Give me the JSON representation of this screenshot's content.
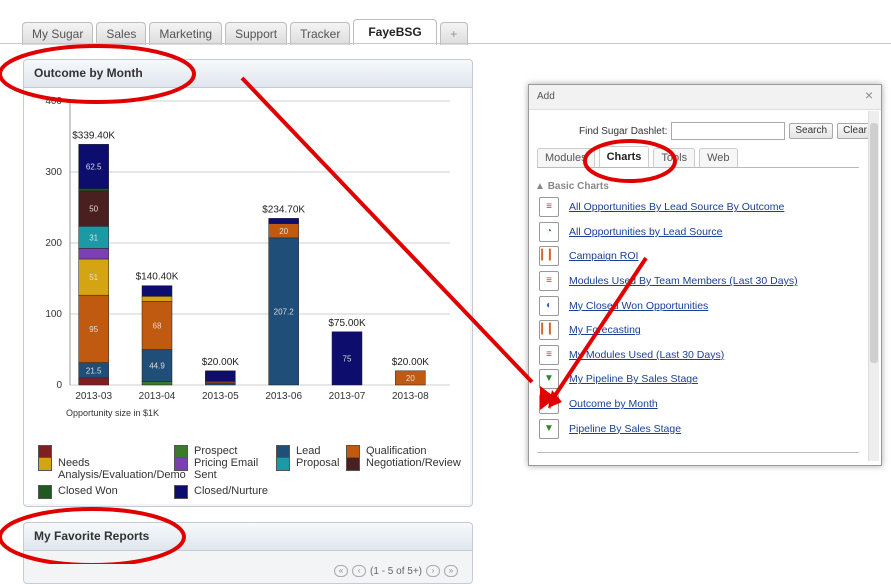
{
  "tabs": [
    "My Sugar",
    "Sales",
    "Marketing",
    "Support",
    "Tracker",
    "FayeBSG",
    "+"
  ],
  "dashlet_outcome": {
    "title": "Outcome by Month"
  },
  "dashlet_reports": {
    "title": "My Favorite Reports",
    "pager": "(1 - 5 of 5+)"
  },
  "chart_data": {
    "type": "bar",
    "title": "",
    "xlabel": "Opportunity size in $1K",
    "ylabel": "",
    "ylim": [
      0,
      400
    ],
    "yticks": [
      "0",
      "100",
      "200",
      "300",
      "400"
    ],
    "categories": [
      "2013-03",
      "2013-04",
      "2013-05",
      "2013-06",
      "2013-07",
      "2013-08"
    ],
    "totals": [
      "$339.40K",
      "$140.40K",
      "$20.00K",
      "$234.70K",
      "$75.00K",
      "$20.00K"
    ],
    "series": [
      {
        "name": "",
        "color": "#7f1f1f",
        "values": [
          10,
          0,
          0,
          0,
          0,
          0
        ],
        "labels": [
          "",
          "",
          "",
          "",
          "",
          ""
        ]
      },
      {
        "name": "Prospect",
        "color": "#3a7a2a",
        "values": [
          0,
          5,
          0,
          0,
          0,
          0
        ],
        "labels": [
          "",
          "",
          "",
          "",
          "",
          ""
        ]
      },
      {
        "name": "Lead",
        "color": "#1f4e79",
        "values": [
          21.5,
          44.9,
          3,
          207.2,
          0,
          0
        ],
        "labels": [
          "21.5",
          "44.9",
          "",
          "207.2",
          "",
          ""
        ]
      },
      {
        "name": "Qualification",
        "color": "#c05a10",
        "values": [
          95,
          68,
          2,
          20,
          0,
          20
        ],
        "labels": [
          "95",
          "68",
          "",
          "20",
          "",
          "20"
        ]
      },
      {
        "name": "Needs Analysis/Evaluation/Demo",
        "color": "#d4a412",
        "values": [
          51,
          7,
          0,
          0,
          0,
          0
        ],
        "labels": [
          "51",
          "",
          "",
          "",
          "",
          ""
        ]
      },
      {
        "name": "Pricing Email Sent",
        "color": "#7a3fb0",
        "values": [
          15,
          0,
          0,
          0,
          0,
          0
        ],
        "labels": [
          "",
          "",
          "",
          "",
          "",
          ""
        ]
      },
      {
        "name": "Proposal",
        "color": "#1b9aa6",
        "values": [
          31,
          0,
          0,
          0,
          0,
          0
        ],
        "labels": [
          "31",
          "",
          "",
          "",
          "",
          ""
        ]
      },
      {
        "name": "Negotiation/Review",
        "color": "#4a1f1f",
        "values": [
          50,
          0,
          0,
          0,
          0,
          0
        ],
        "labels": [
          "50",
          "",
          "",
          "",
          "",
          ""
        ]
      },
      {
        "name": "Closed Won",
        "color": "#1f5a1f",
        "values": [
          3,
          0,
          0,
          0,
          0,
          0
        ],
        "labels": [
          "",
          "",
          "",
          "",
          "",
          ""
        ]
      },
      {
        "name": "Closed/Nurture",
        "color": "#0d0d6e",
        "values": [
          62.5,
          15,
          15,
          7.5,
          75,
          0
        ],
        "labels": [
          "62.5",
          "",
          "",
          "",
          "75",
          ""
        ]
      }
    ]
  },
  "legend": [
    {
      "label": "",
      "color": "#7f1f1f"
    },
    {
      "label": "Prospect",
      "color": "#3a7a2a"
    },
    {
      "label": "Lead",
      "color": "#1f4e79"
    },
    {
      "label": "Qualification",
      "color": "#c05a10"
    },
    {
      "label": "Needs Analysis/Evaluation/Demo",
      "color": "#d4a412"
    },
    {
      "label": "Pricing Email Sent",
      "color": "#7a3fb0"
    },
    {
      "label": "Proposal",
      "color": "#1b9aa6"
    },
    {
      "label": "Negotiation/Review",
      "color": "#4a1f1f"
    },
    {
      "label": "Closed Won",
      "color": "#1f5a1f"
    },
    {
      "label": "Closed/Nurture",
      "color": "#0d0d6e"
    }
  ],
  "modal": {
    "title": "Add",
    "close": "×",
    "find_label": "Find Sugar Dashlet:",
    "find_value": "",
    "search_btn": "Search",
    "clear_btn": "Clear",
    "tabs": [
      "Modules",
      "Charts",
      "Tools",
      "Web"
    ],
    "section": "Basic Charts",
    "items": [
      "All Opportunities By Lead Source By Outcome",
      "All Opportunities by Lead Source",
      "Campaign ROI",
      "Modules Used By Team Members (Last 30 Days)",
      "My Closed Won Opportunities",
      "My Forecasting",
      "My Modules Used (Last 30 Days)",
      "My Pipeline By Sales Stage",
      "Outcome by Month",
      "Pipeline By Sales Stage"
    ]
  }
}
